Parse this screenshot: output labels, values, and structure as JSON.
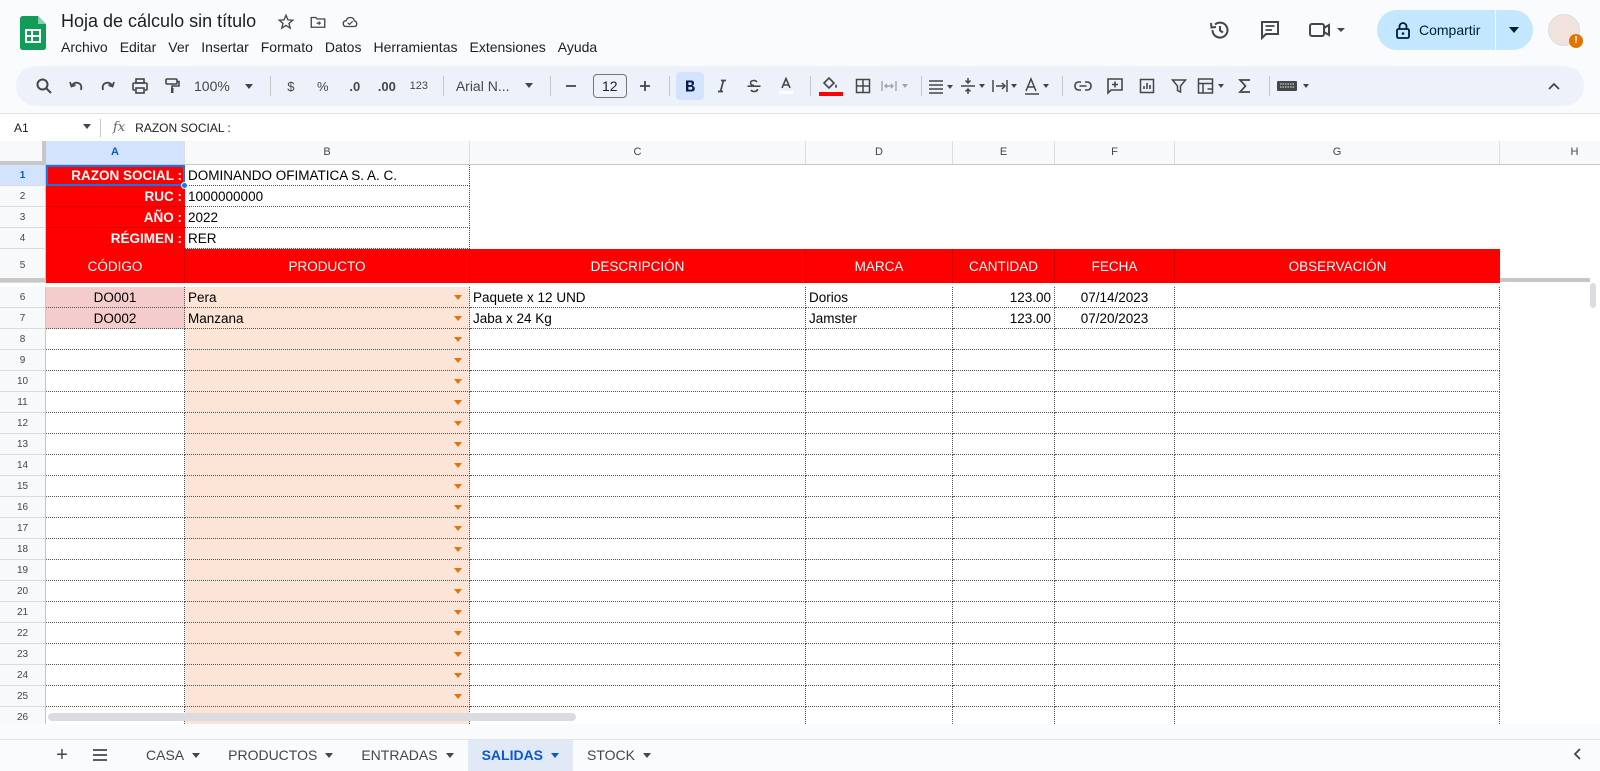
{
  "doc": {
    "title": "Hoja de cálculo sin título",
    "menus": [
      "Archivo",
      "Editar",
      "Ver",
      "Insertar",
      "Formato",
      "Datos",
      "Herramientas",
      "Extensiones",
      "Ayuda"
    ]
  },
  "share": {
    "label": "Compartir"
  },
  "toolbar": {
    "zoom": "100%",
    "currency": "$",
    "percent": "%",
    "dec_less": ".0",
    "dec_more": ".00",
    "format_123": "123",
    "font": "Arial N...",
    "font_size": "12"
  },
  "formula_bar": {
    "name_box": "A1",
    "value": "RAZON SOCIAL :"
  },
  "columns": [
    "A",
    "B",
    "C",
    "D",
    "E",
    "F",
    "G",
    "H"
  ],
  "rows": [
    "1",
    "2",
    "3",
    "4",
    "5",
    "6",
    "7",
    "8",
    "9",
    "10",
    "11",
    "12",
    "13",
    "14",
    "15",
    "16",
    "17",
    "18",
    "19",
    "20",
    "21",
    "22",
    "23",
    "24",
    "25",
    "26"
  ],
  "info": [
    {
      "label": "RAZON SOCIAL :",
      "value": "DOMINANDO OFIMATICA S. A. C."
    },
    {
      "label": "RUC :",
      "value": "1000000000"
    },
    {
      "label": "AÑO :",
      "value": "2022"
    },
    {
      "label": "RÉGIMEN :",
      "value": "RER"
    }
  ],
  "table_headers": [
    "CÓDIGO",
    "PRODUCTO",
    "DESCRIPCIÓN",
    "MARCA",
    "CANTIDAD",
    "FECHA",
    "OBSERVACIÓN"
  ],
  "table_rows": [
    {
      "codigo": "DO001",
      "producto": "Pera",
      "descripcion": "Paquete x 12 UND",
      "marca": "Dorios",
      "cantidad": "123.00",
      "fecha": "07/14/2023",
      "observacion": ""
    },
    {
      "codigo": "DO002",
      "producto": "Manzana",
      "descripcion": "Jaba x 24 Kg",
      "marca": "Jamster",
      "cantidad": "123.00",
      "fecha": "07/20/2023",
      "observacion": ""
    }
  ],
  "sheets": [
    {
      "name": "CASA",
      "active": false
    },
    {
      "name": "PRODUCTOS",
      "active": false
    },
    {
      "name": "ENTRADAS",
      "active": false
    },
    {
      "name": "SALIDAS",
      "active": true
    },
    {
      "name": "STOCK",
      "active": false
    }
  ],
  "colors": {
    "header_red": "#ff0000",
    "codigo_fill": "#f4cccc",
    "producto_fill": "#fce5d7",
    "dropdown": "#e8710a",
    "accent": "#0b57d0"
  }
}
